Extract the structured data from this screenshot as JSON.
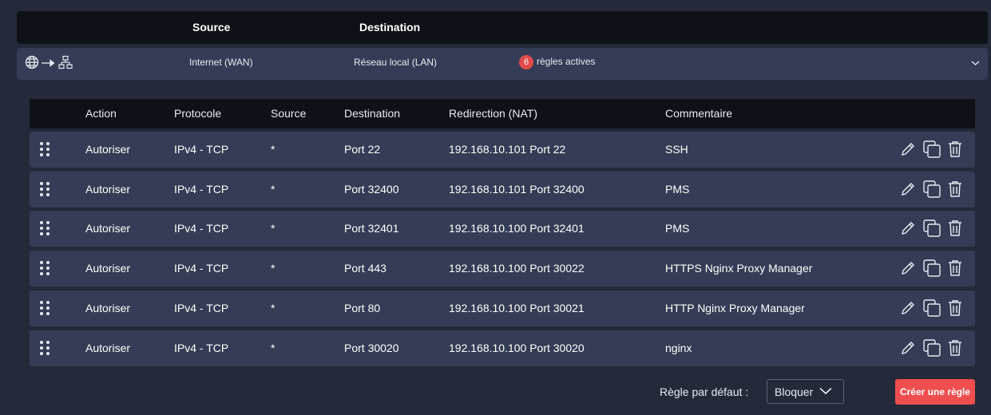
{
  "header": {
    "source_label": "Source",
    "destination_label": "Destination"
  },
  "flow": {
    "icons": [
      "globe-icon",
      "arrow-right-icon",
      "network-icon"
    ],
    "source": "Internet (WAN)",
    "destination": "Réseau local (LAN)",
    "active_count": "6",
    "active_label": "règles actives"
  },
  "table": {
    "columns": [
      "Action",
      "Protocole",
      "Source",
      "Destination",
      "Redirection (NAT)",
      "Commentaire"
    ],
    "rows": [
      {
        "action": "Autoriser",
        "protocol": "IPv4 - TCP",
        "source": "*",
        "destination": "Port 22",
        "nat": "192.168.10.101 Port 22",
        "comment": "SSH"
      },
      {
        "action": "Autoriser",
        "protocol": "IPv4 - TCP",
        "source": "*",
        "destination": "Port 32400",
        "nat": "192.168.10.101 Port 32400",
        "comment": "PMS"
      },
      {
        "action": "Autoriser",
        "protocol": "IPv4 - TCP",
        "source": "*",
        "destination": "Port 32401",
        "nat": "192.168.10.100 Port 32401",
        "comment": "PMS"
      },
      {
        "action": "Autoriser",
        "protocol": "IPv4 - TCP",
        "source": "*",
        "destination": "Port 443",
        "nat": "192.168.10.100 Port 30022",
        "comment": "HTTPS Nginx Proxy Manager"
      },
      {
        "action": "Autoriser",
        "protocol": "IPv4 - TCP",
        "source": "*",
        "destination": "Port 80",
        "nat": "192.168.10.100 Port 30021",
        "comment": "HTTP Nginx Proxy Manager"
      },
      {
        "action": "Autoriser",
        "protocol": "IPv4 - TCP",
        "source": "*",
        "destination": "Port 30020",
        "nat": "192.168.10.100 Port 30020",
        "comment": "nginx"
      }
    ],
    "row_icons": [
      "drag-handle-icon",
      "edit-icon",
      "duplicate-icon",
      "delete-icon"
    ]
  },
  "footer": {
    "default_rule_label": "Règle par défaut :",
    "default_rule_value": "Bloquer",
    "create_button": "Créer une règle"
  },
  "colors": {
    "accent": "#ef4e4e",
    "row_bg": "#343d55",
    "header_bg": "#0e1118",
    "page_bg": "#242a3a"
  }
}
